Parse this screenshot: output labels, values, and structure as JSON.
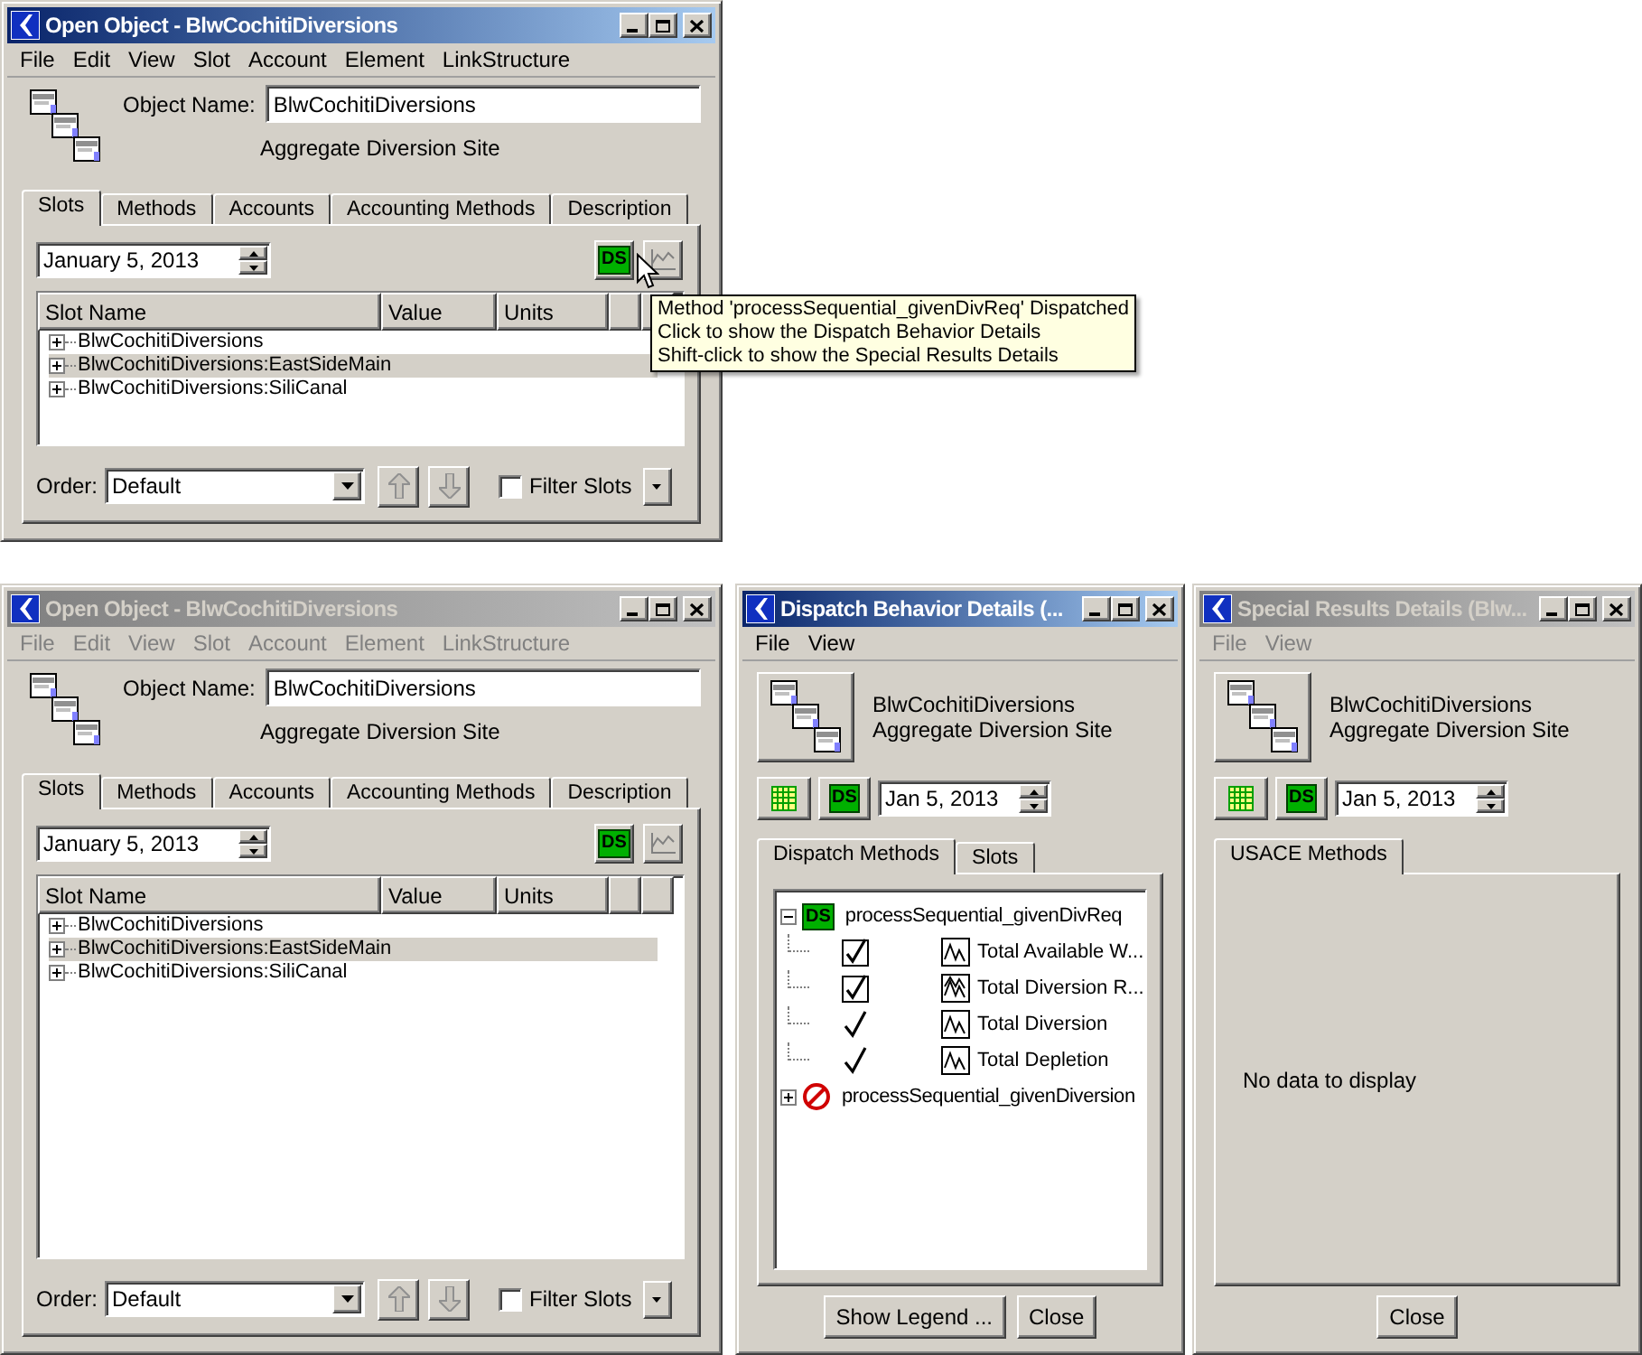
{
  "windows": [
    {
      "kind": "open_object",
      "title": "Open Object - BlwCochitiDiversions",
      "active": true,
      "menu": [
        "File",
        "Edit",
        "View",
        "Slot",
        "Account",
        "Element",
        "LinkStructure"
      ],
      "object_name_label": "Object Name:",
      "object_name": "BlwCochitiDiversions",
      "object_type": "Aggregate Diversion Site",
      "tabs": [
        {
          "label": "Slots",
          "selected": true
        },
        {
          "label": "Methods",
          "selected": false
        },
        {
          "label": "Accounts",
          "selected": false
        },
        {
          "label": "Accounting Methods",
          "selected": false
        },
        {
          "label": "Description",
          "selected": false
        }
      ],
      "date": "January 5, 2013",
      "dispatch_button": "DS",
      "columns": [
        "Slot Name",
        "Value",
        "Units"
      ],
      "rows": [
        {
          "name": "BlwCochitiDiversions",
          "selected": false
        },
        {
          "name": "BlwCochitiDiversions:EastSideMain",
          "selected": true
        },
        {
          "name": "BlwCochitiDiversions:SiliCanal",
          "selected": false
        }
      ],
      "order_label": "Order:",
      "order": "Default",
      "filter": {
        "label": "Filter Slots",
        "checked": false
      },
      "tooltip": [
        "Method 'processSequential_givenDivReq' Dispatched",
        "Click to show the Dispatch Behavior Details",
        "Shift-click to show the Special Results Details"
      ]
    },
    {
      "kind": "open_object",
      "title": "Open Object - BlwCochitiDiversions",
      "active": false,
      "menu": [
        "File",
        "Edit",
        "View",
        "Slot",
        "Account",
        "Element",
        "LinkStructure"
      ],
      "object_name_label": "Object Name:",
      "object_name": "BlwCochitiDiversions",
      "object_type": "Aggregate Diversion Site",
      "tabs": [
        {
          "label": "Slots",
          "selected": true
        },
        {
          "label": "Methods",
          "selected": false
        },
        {
          "label": "Accounts",
          "selected": false
        },
        {
          "label": "Accounting Methods",
          "selected": false
        },
        {
          "label": "Description",
          "selected": false
        }
      ],
      "date": "January 5, 2013",
      "dispatch_button": "DS",
      "columns": [
        "Slot Name",
        "Value",
        "Units"
      ],
      "rows": [
        {
          "name": "BlwCochitiDiversions",
          "selected": false
        },
        {
          "name": "BlwCochitiDiversions:EastSideMain",
          "selected": true
        },
        {
          "name": "BlwCochitiDiversions:SiliCanal",
          "selected": false
        }
      ],
      "order_label": "Order:",
      "order": "Default",
      "filter": {
        "label": "Filter Slots",
        "checked": false
      }
    },
    {
      "kind": "dispatch_details",
      "title": "Dispatch Behavior Details (...",
      "active": true,
      "menu": [
        "File",
        "View"
      ],
      "object_name": "BlwCochitiDiversions",
      "object_type": "Aggregate Diversion Site",
      "dispatch_button": "DS",
      "date": "Jan 5, 2013",
      "tabs": [
        {
          "label": "Dispatch Methods",
          "selected": true
        },
        {
          "label": "Slots",
          "selected": false
        }
      ],
      "tree": [
        {
          "label": "processSequential_givenDivReq",
          "dispatched": true,
          "badge": "DS",
          "expanded": true,
          "children": [
            {
              "label": "Total Available W...",
              "boxed": true,
              "multi_series": false
            },
            {
              "label": "Total Diversion R...",
              "boxed": true,
              "multi_series": true
            },
            {
              "label": "Total Diversion",
              "boxed": false,
              "multi_series": false
            },
            {
              "label": "Total Depletion",
              "boxed": false,
              "multi_series": false
            }
          ]
        },
        {
          "label": "processSequential_givenDiversion",
          "dispatched": false,
          "expanded": false
        }
      ],
      "buttons": [
        "Show Legend ...",
        "Close"
      ]
    },
    {
      "kind": "special_results",
      "title": "Special Results Details (Blw...",
      "active": false,
      "menu": [
        "File",
        "View"
      ],
      "object_name": "BlwCochitiDiversions",
      "object_type": "Aggregate Diversion Site",
      "dispatch_button": "DS",
      "date": "Jan 5, 2013",
      "tabs": [
        {
          "label": "USACE Methods",
          "selected": true
        }
      ],
      "message": "No data to display",
      "buttons": [
        "Close"
      ]
    }
  ]
}
